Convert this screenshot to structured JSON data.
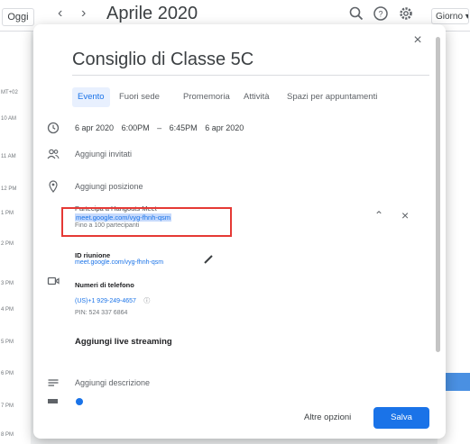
{
  "header": {
    "today_label": "Oggi",
    "prev_arrow": "‹",
    "next_arrow": "›",
    "month_title": "Aprile 2020",
    "view_label": "Giorno",
    "icons": [
      "search-icon",
      "help-icon",
      "settings-icon"
    ]
  },
  "time_column": {
    "labels": [
      "MT+02",
      "10 AM",
      "11 AM",
      "12 PM",
      "1 PM",
      "2 PM",
      "3 PM",
      "4 PM",
      "5 PM",
      "6 PM",
      "7 PM",
      "8 PM"
    ]
  },
  "dialog": {
    "close_glyph": "×",
    "title": "Consiglio di Classe 5C",
    "tabs": [
      "Evento",
      "Fuori sede",
      "Promemoria",
      "Attività",
      "Spazi per appuntamenti"
    ],
    "date_row": {
      "start_date": "6 apr 2020",
      "start_time": "6:00PM",
      "separator": "–",
      "end_time": "6:45PM",
      "end_date": "6 apr 2020"
    },
    "add_guests": "Aggiungi invitati",
    "add_location": "Aggiungi posizione",
    "conference": {
      "label": "Partecipa a Hangouts Meet",
      "link": "meet.google.com/vyg-fhnh-qsm",
      "sub": "Fino a 100 partecipanti"
    },
    "meeting_id_label": "ID riunione",
    "meeting_id_link": "meet.google.com/vyg-fhnh-qsm",
    "phone_label": "Numeri di telefono",
    "phone_number": "(US)+1 929-249-4657",
    "pin": "PIN: 524 337 6864",
    "live_streaming": "Aggiungi live streaming",
    "add_description": "Aggiungi descrizione",
    "more_options": "Altre opzioni",
    "save": "Salva"
  },
  "colors": {
    "accent": "#1a73e8",
    "highlight_box": "#e53935",
    "link_selection": "#c6dafc"
  }
}
